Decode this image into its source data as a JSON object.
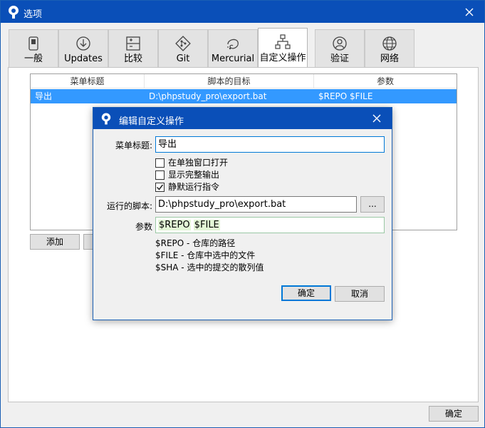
{
  "window": {
    "title": "选项",
    "close_icon": "close-icon"
  },
  "tabs": [
    {
      "label": "一般",
      "icon": "switch-icon"
    },
    {
      "label": "Updates",
      "icon": "download-icon"
    },
    {
      "label": "比较",
      "icon": "diff-icon"
    },
    {
      "label": "Git",
      "icon": "git-icon"
    },
    {
      "label": "Mercurial",
      "icon": "mercurial-icon"
    },
    {
      "label": "自定义操作",
      "icon": "custom-actions-icon"
    },
    {
      "label": "验证",
      "icon": "user-icon"
    },
    {
      "label": "网络",
      "icon": "globe-icon"
    }
  ],
  "active_tab": "自定义操作",
  "actions_table": {
    "columns": [
      "菜单标题",
      "脚本的目标",
      "参数"
    ],
    "rows": [
      {
        "menu_title": "导出",
        "script": "D:\\phpstudy_pro\\export.bat",
        "params": "$REPO $FILE"
      }
    ]
  },
  "buttons": {
    "add": "添加",
    "ok": "确定"
  },
  "dialog": {
    "title": "编辑自定义操作",
    "menu_title_label": "菜单标题:",
    "menu_title_value": "导出",
    "checkboxes": [
      {
        "label": "在单独窗口打开",
        "checked": false
      },
      {
        "label": "显示完整输出",
        "checked": false
      },
      {
        "label": "静默运行指令",
        "checked": true
      }
    ],
    "script_label": "运行的脚本:",
    "script_value": "D:\\phpstudy_pro\\export.bat",
    "browse_label": "...",
    "params_label": "参数",
    "params_tokens": [
      "$REPO",
      "$FILE"
    ],
    "help_lines": [
      "$REPO - 仓库的路径",
      "$FILE - 仓库中选中的文件",
      "$SHA - 选中的提交的散列值"
    ],
    "ok_label": "确定",
    "cancel_label": "取消"
  },
  "colors": {
    "title_bar": "#0a4fb8",
    "selection": "#3399ff",
    "focus_border": "#0078d7",
    "token_bg": "#e3f6d6"
  }
}
